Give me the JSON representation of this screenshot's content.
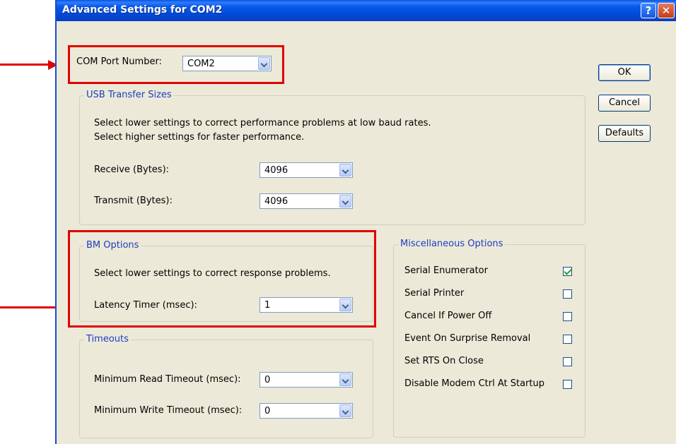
{
  "window": {
    "title": "Advanced Settings for COM2",
    "help_glyph": "?",
    "close_glyph": "✕"
  },
  "com_port": {
    "label": "COM Port Number:",
    "value": "COM2"
  },
  "usb": {
    "legend": "USB Transfer Sizes",
    "desc1": "Select lower settings to correct performance problems at low baud rates.",
    "desc2": "Select higher settings for faster performance.",
    "receive_label": "Receive (Bytes):",
    "receive_value": "4096",
    "transmit_label": "Transmit (Bytes):",
    "transmit_value": "4096"
  },
  "bm": {
    "legend": "BM Options",
    "desc": "Select lower settings to correct response problems.",
    "latency_label": "Latency Timer (msec):",
    "latency_value": "1"
  },
  "timeouts": {
    "legend": "Timeouts",
    "read_label": "Minimum Read Timeout (msec):",
    "read_value": "0",
    "write_label": "Minimum Write Timeout (msec):",
    "write_value": "0"
  },
  "misc": {
    "legend": "Miscellaneous Options",
    "items": [
      {
        "label": "Serial Enumerator",
        "checked": true
      },
      {
        "label": "Serial Printer",
        "checked": false
      },
      {
        "label": "Cancel If Power Off",
        "checked": false
      },
      {
        "label": "Event On Surprise Removal",
        "checked": false
      },
      {
        "label": "Set RTS On Close",
        "checked": false
      },
      {
        "label": "Disable Modem Ctrl At Startup",
        "checked": false
      }
    ]
  },
  "buttons": {
    "ok": "OK",
    "cancel": "Cancel",
    "defaults": "Defaults"
  },
  "annotation_color": "#e00000"
}
